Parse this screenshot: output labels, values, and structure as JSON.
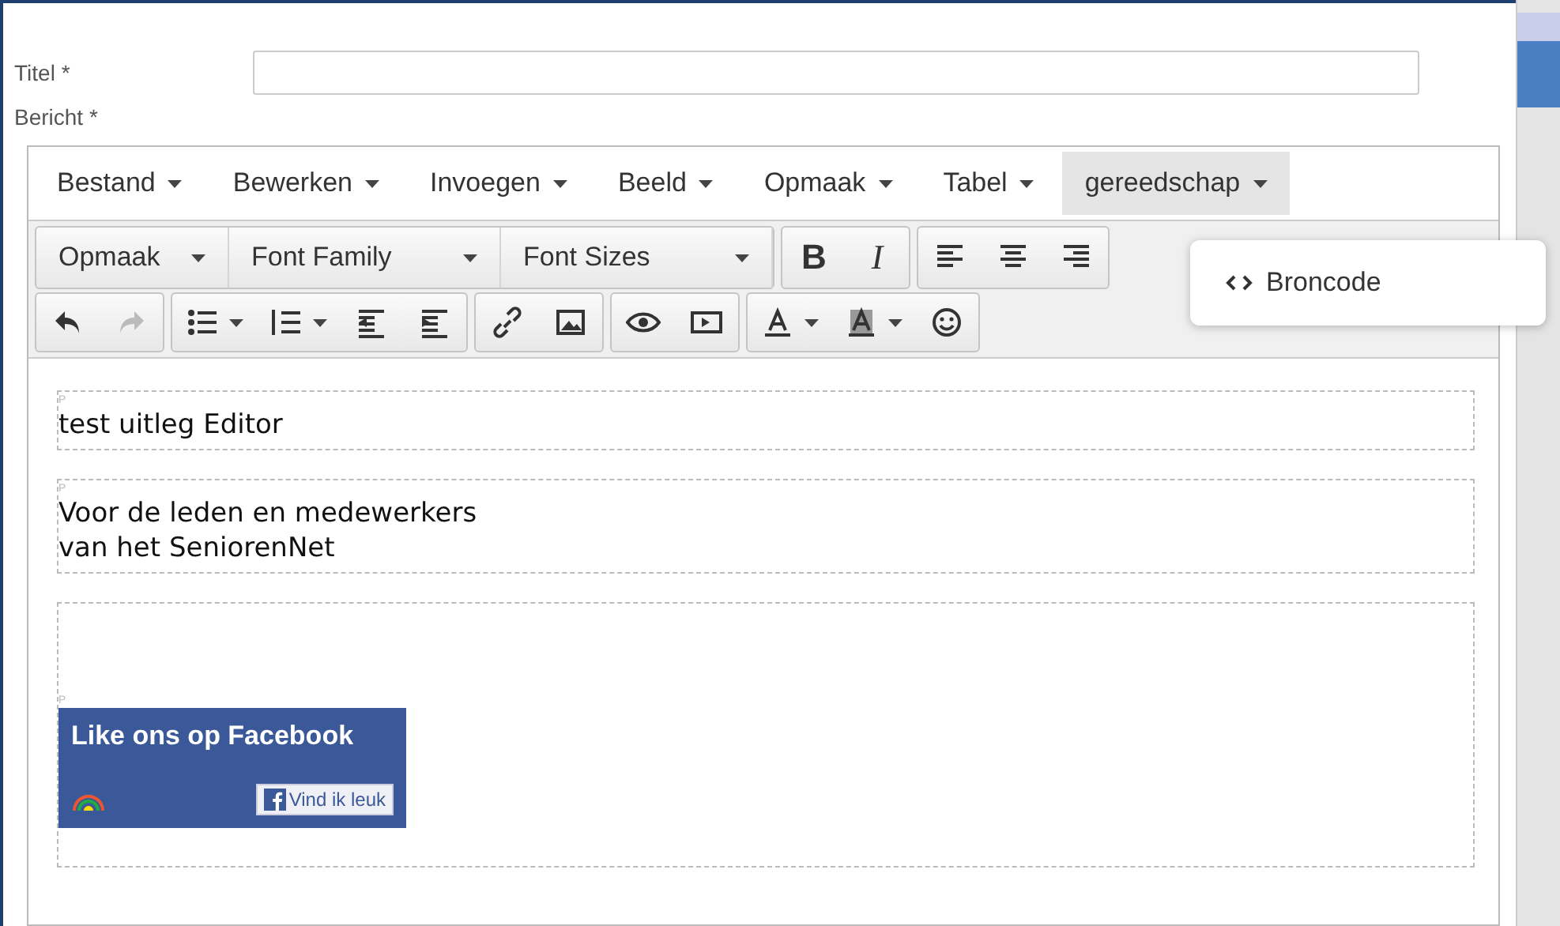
{
  "form": {
    "title_label": "Titel *",
    "message_label": "Bericht *"
  },
  "menubar": [
    {
      "label": "Bestand",
      "selected": false
    },
    {
      "label": "Bewerken",
      "selected": false
    },
    {
      "label": "Invoegen",
      "selected": false
    },
    {
      "label": "Beeld",
      "selected": false
    },
    {
      "label": "Opmaak",
      "selected": false
    },
    {
      "label": "Tabel",
      "selected": false
    },
    {
      "label": "gereedschap",
      "selected": true
    }
  ],
  "format_selects": [
    "Opmaak",
    "Font Family",
    "Font Sizes"
  ],
  "style_buttons": [
    "B",
    "I"
  ],
  "dropdown": {
    "items": [
      "Broncode"
    ]
  },
  "paragraphs": [
    {
      "marker": "P",
      "lines": [
        "test uitleg Editor"
      ]
    },
    {
      "marker": "P",
      "lines": [
        "Voor de leden en medewerkers",
        "van het SeniorenNet"
      ]
    },
    {
      "marker": "P"
    }
  ],
  "facebook_widget": {
    "title": "Like ons op Facebook",
    "button": "Vind ik leuk"
  }
}
